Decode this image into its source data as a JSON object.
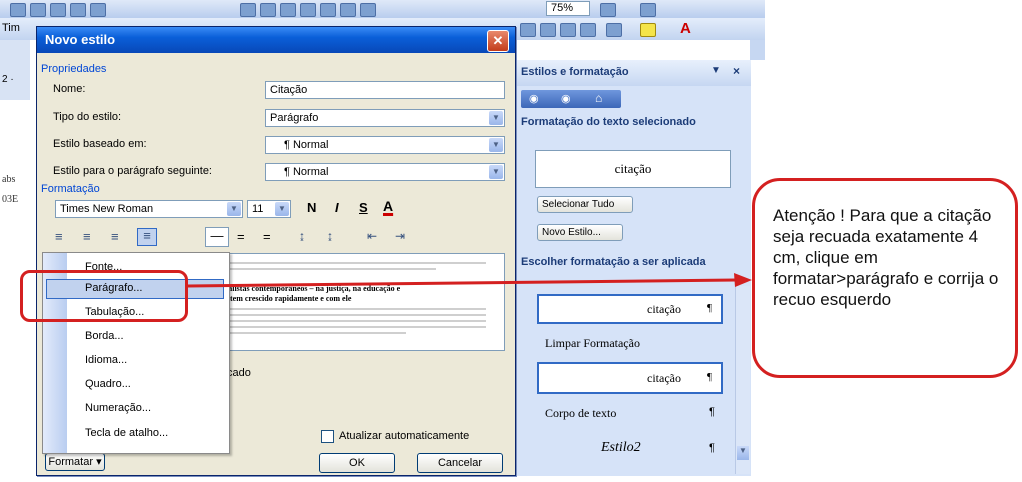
{
  "background": {
    "zoom": "75%",
    "font_partial": "Tim",
    "ruler_partial": "2 ·",
    "left_text_1": "abs",
    "left_text_2": "03E"
  },
  "dialog": {
    "title": "Novo estilo",
    "properties_group": "Propriedades",
    "name_label": "Nome:",
    "name_value": "Citação",
    "type_label": "Tipo do estilo:",
    "type_value": "Parágrafo",
    "based_on_label": "Estilo baseado em:",
    "based_on_value": "¶ Normal",
    "next_label": "Estilo para o parágrafo seguinte:",
    "next_value": "¶ Normal",
    "formatting_group": "Formatação",
    "font_value": "Times New Roman",
    "size_value": "11",
    "bold": "N",
    "italic": "I",
    "underline": "S",
    "font_color": "A",
    "preview_text_1": "e jornalistas contemporâneos – na justiça, na educação e",
    "preview_text_2": "muito tem crescido rapidamente e com ele",
    "description_fragment": "cado",
    "auto_update_label": "Atualizar automaticamente",
    "ok_label": "OK",
    "cancel_label": "Cancelar",
    "format_button": "Formatar ▾"
  },
  "menu": {
    "items": [
      "Fonte...",
      "Parágrafo...",
      "Tabulação...",
      "Borda...",
      "Idioma...",
      "Quadro...",
      "Numeração...",
      "Tecla de atalho..."
    ],
    "highlighted": "Parágrafo..."
  },
  "pane": {
    "title": "Estilos e formatação",
    "selected_heading": "Formatação do texto selecionado",
    "selected_style": "citação",
    "select_all": "Selecionar Tudo",
    "new_style": "Novo Estilo...",
    "apply_heading": "Escolher formatação a ser aplicada",
    "styles": [
      "citação",
      "Limpar Formatação",
      "citação",
      "Corpo de texto",
      "Estilo2"
    ],
    "para_mark": "¶"
  },
  "annotation": {
    "text": "Atenção ! Para que a citação seja recuada exatamente 4 cm, clique em formatar>parágrafo e corrija o recuo esquerdo",
    "color": "#d42020"
  }
}
